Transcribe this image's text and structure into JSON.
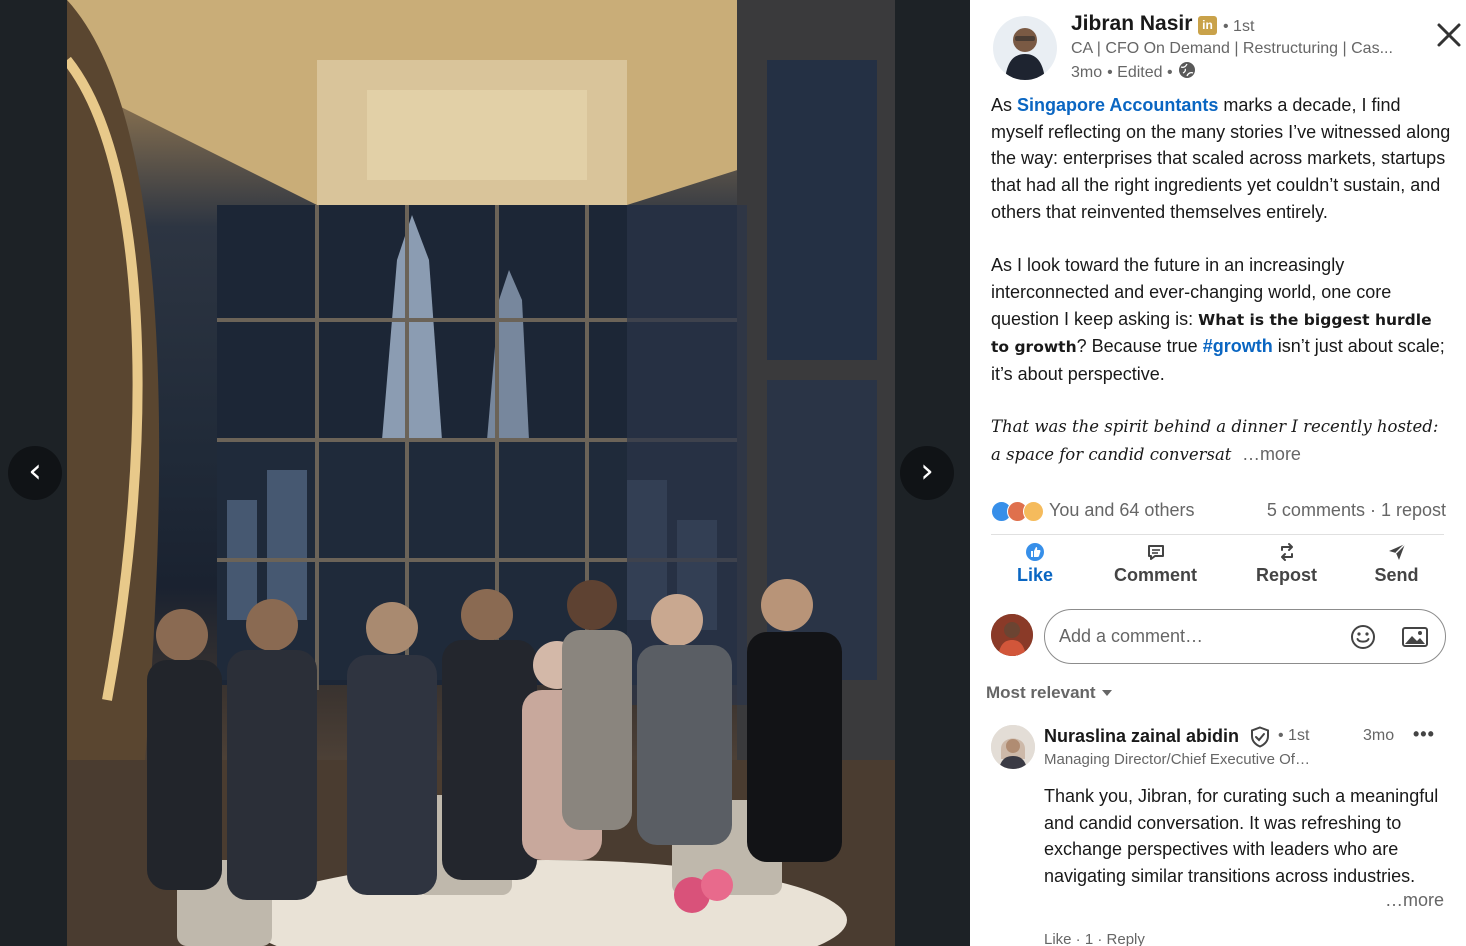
{
  "viewer": {
    "prev_glyph": "‹",
    "next_glyph": "›",
    "photo_icon": "group-dinner-photo"
  },
  "author": {
    "name": "Jibran Nasir",
    "badge": "in",
    "degree": "• 1st",
    "headline": "CA | CFO On Demand | Restructuring | Cas...",
    "time": "3mo",
    "edited": "• Edited •",
    "visibility_icon": "globe-icon"
  },
  "post": {
    "p1_pre": "As ",
    "p1_link": "Singapore Accountants",
    "p1_post": " marks a decade, I find myself reflecting on the many stories I’ve witnessed along the way: enterprises that scaled across markets, startups that had all the right ingredients yet couldn’t sustain, and others that reinvented themselves entirely.",
    "p2_pre": "As I look toward the future in an increasingly interconnected and ever-changing world, one core question I keep asking is: ",
    "p2_bold": "What is the biggest hurdle to growth",
    "p2_mid": "? Because true ",
    "p2_hashtag": "#growth",
    "p2_post": " isn’t just about scale; it’s about perspective.",
    "p3_italic": "That was the spirit behind a dinner I recently hosted: a space for candid conversat",
    "more": "…more"
  },
  "reactions": {
    "text": "You and 64 others",
    "comments_reposts": "5 comments · 1 repost",
    "icons": [
      "like-icon",
      "love-icon",
      "insightful-icon"
    ]
  },
  "actions": {
    "like": "Like",
    "comment": "Comment",
    "repost": "Repost",
    "send": "Send"
  },
  "comment_box": {
    "placeholder": "Add a comment…"
  },
  "sort": {
    "label": "Most relevant"
  },
  "comment": {
    "name": "Nuraslina zainal abidin",
    "degree": "• 1st",
    "time": "3mo",
    "menu": "•••",
    "headline": "Managing Director/Chief Executive Of…",
    "body": "Thank you, Jibran, for curating such a meaningful and candid conversation. It was refreshing to exchange perspectives with leaders who are navigating similar transitions across industries.",
    "more": "…more",
    "footer": "Like · 1 · Reply"
  },
  "colors": {
    "link": "#0a66c2",
    "background": "#1d2226"
  }
}
